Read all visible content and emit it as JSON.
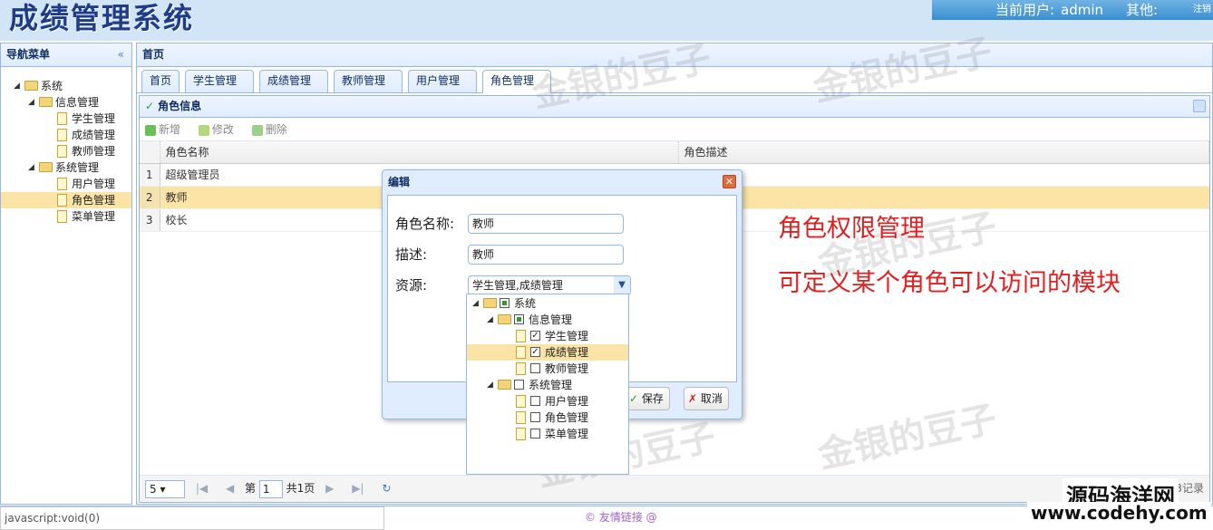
{
  "header": {
    "title": "成绩管理系统",
    "current_user_label": "当前用户:",
    "current_user": "admin",
    "other_label": "其他:",
    "logout": "注销"
  },
  "nav": {
    "title": "导航菜单",
    "collapse": "«",
    "tree": [
      {
        "label": "系统",
        "level": 0,
        "type": "folder",
        "open": true
      },
      {
        "label": "信息管理",
        "level": 1,
        "type": "folder",
        "open": true
      },
      {
        "label": "学生管理",
        "level": 2,
        "type": "file"
      },
      {
        "label": "成绩管理",
        "level": 2,
        "type": "file"
      },
      {
        "label": "教师管理",
        "level": 2,
        "type": "file"
      },
      {
        "label": "系统管理",
        "level": 1,
        "type": "folder",
        "open": true
      },
      {
        "label": "用户管理",
        "level": 2,
        "type": "file"
      },
      {
        "label": "角色管理",
        "level": 2,
        "type": "file",
        "selected": true
      },
      {
        "label": "菜单管理",
        "level": 2,
        "type": "file"
      }
    ]
  },
  "main": {
    "title": "首页",
    "tabs": [
      {
        "label": "首页",
        "closable": false
      },
      {
        "label": "学生管理",
        "closable": true
      },
      {
        "label": "成绩管理",
        "closable": true
      },
      {
        "label": "教师管理",
        "closable": true
      },
      {
        "label": "用户管理",
        "closable": true
      },
      {
        "label": "角色管理",
        "closable": true,
        "active": true
      }
    ]
  },
  "role_panel": {
    "title": "角色信息",
    "toolbar": {
      "add": "新增",
      "edit": "修改",
      "delete": "删除"
    },
    "columns": [
      "角色名称",
      "角色描述"
    ],
    "rows": [
      {
        "num": "1",
        "name": "超级管理员",
        "desc": ""
      },
      {
        "num": "2",
        "name": "教师",
        "desc": "",
        "selected": true
      },
      {
        "num": "3",
        "name": "校长",
        "desc": ""
      }
    ]
  },
  "pager": {
    "page_size": "5",
    "page_prefix": "第",
    "page": "1",
    "page_suffix": "共1页",
    "info": "显示1到3,共3记录"
  },
  "dialog": {
    "title": "编辑",
    "name_label": "角色名称:",
    "name_value": "教师",
    "desc_label": "描述:",
    "desc_value": "教师",
    "res_label": "资源:",
    "res_value": "学生管理,成绩管理",
    "save": "保存",
    "cancel": "取消",
    "tree": [
      {
        "label": "系统",
        "level": 0,
        "type": "folder",
        "check": "partial"
      },
      {
        "label": "信息管理",
        "level": 1,
        "type": "folder",
        "check": "partial"
      },
      {
        "label": "学生管理",
        "level": 2,
        "type": "file",
        "check": "checked"
      },
      {
        "label": "成绩管理",
        "level": 2,
        "type": "file",
        "check": "checked",
        "selected": true
      },
      {
        "label": "教师管理",
        "level": 2,
        "type": "file",
        "check": "none"
      },
      {
        "label": "系统管理",
        "level": 1,
        "type": "folder",
        "check": "none"
      },
      {
        "label": "用户管理",
        "level": 2,
        "type": "file",
        "check": "none"
      },
      {
        "label": "角色管理",
        "level": 2,
        "type": "file",
        "check": "none"
      },
      {
        "label": "菜单管理",
        "level": 2,
        "type": "file",
        "check": "none"
      }
    ]
  },
  "annotation": {
    "line1": "角色权限管理",
    "line2": "可定义某个角色可以访问的模块"
  },
  "watermark": "金银的豆子",
  "footer": {
    "status": "javascript:void(0)",
    "friend": "© 友情链接 @"
  },
  "source": {
    "name": "源码海洋网",
    "url": "www.codehy.com"
  }
}
